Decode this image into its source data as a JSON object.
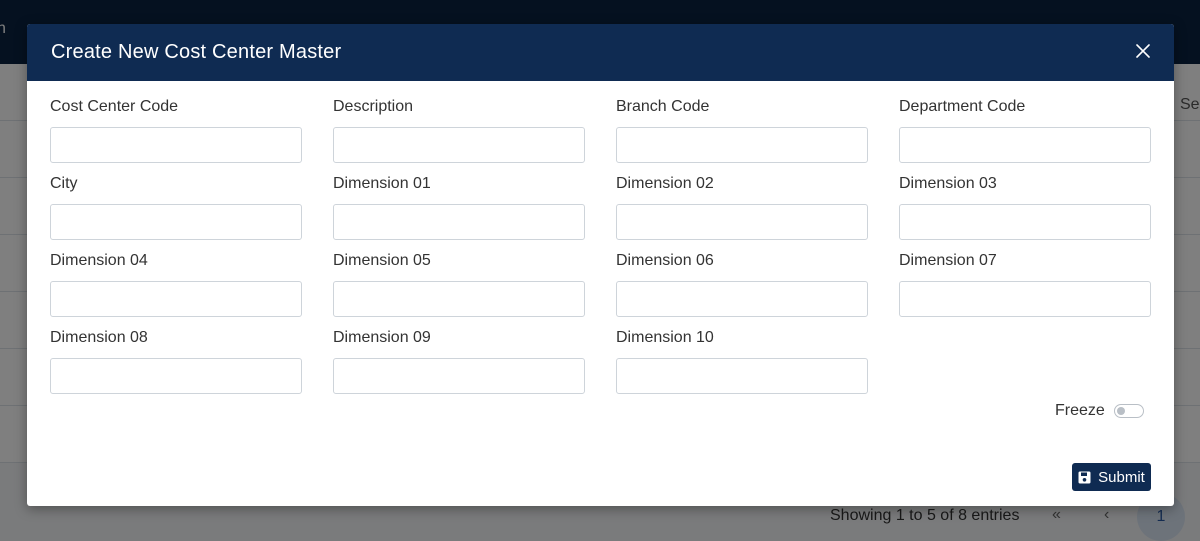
{
  "background": {
    "topbar_text": "n",
    "search_text": "Se",
    "showing_text": "Showing 1 to 5 of 8 entries",
    "pager": {
      "first": "«",
      "prev": "‹",
      "current": "1"
    }
  },
  "modal": {
    "title": "Create New Cost Center Master",
    "close_icon": "close-icon",
    "fields": {
      "cost_center_code": {
        "label": "Cost Center Code",
        "value": ""
      },
      "description": {
        "label": "Description",
        "value": ""
      },
      "branch_code": {
        "label": "Branch Code",
        "value": ""
      },
      "department_code": {
        "label": "Department Code",
        "value": ""
      },
      "city": {
        "label": "City",
        "value": ""
      },
      "dimension_01": {
        "label": "Dimension 01",
        "value": ""
      },
      "dimension_02": {
        "label": "Dimension 02",
        "value": ""
      },
      "dimension_03": {
        "label": "Dimension 03",
        "value": ""
      },
      "dimension_04": {
        "label": "Dimension 04",
        "value": ""
      },
      "dimension_05": {
        "label": "Dimension 05",
        "value": ""
      },
      "dimension_06": {
        "label": "Dimension 06",
        "value": ""
      },
      "dimension_07": {
        "label": "Dimension 07",
        "value": ""
      },
      "dimension_08": {
        "label": "Dimension 08",
        "value": ""
      },
      "dimension_09": {
        "label": "Dimension 09",
        "value": ""
      },
      "dimension_10": {
        "label": "Dimension 10",
        "value": ""
      }
    },
    "freeze": {
      "label": "Freeze",
      "checked": false
    },
    "submit": {
      "label": "Submit",
      "icon": "save-icon"
    }
  },
  "colors": {
    "header": "#0f2b52",
    "topbar": "#0b2341",
    "button": "#0f2b52"
  }
}
